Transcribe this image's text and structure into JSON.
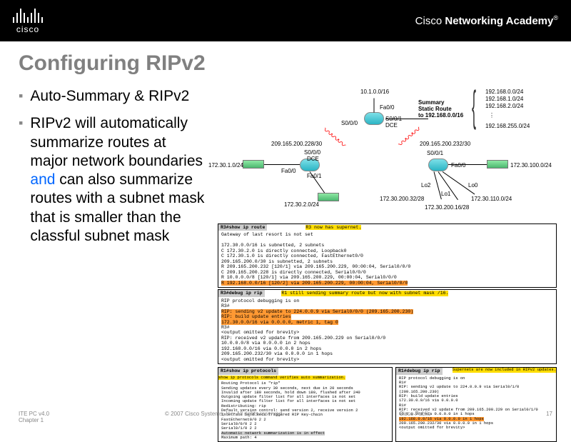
{
  "header": {
    "brand": "cisco",
    "academy_plain": "Cisco ",
    "academy_bold": "Networking Academy"
  },
  "title": "Configuring RIPv2",
  "bullets": {
    "b1": "Auto-Summary & RIPv2",
    "b2a": "RIPv2 will automatically summarize routes at major network boundaries ",
    "b2emph": "and",
    "b2b": " can also summarize routes with a subnet mask that is smaller than the classful subnet mask"
  },
  "diagram": {
    "top": "10.1.0.0/16",
    "sum1": "Summary",
    "sum2": "Static Route",
    "sum3": "to 192.168.0.0/16",
    "nets_right": [
      "192.168.0.0/24",
      "192.168.1.0/24",
      "192.168.2.0/24",
      "192.168.255.0/24"
    ],
    "r2_fa00": "Fa0/0",
    "r2_s000": "S0/0/0",
    "r2_s001": "S0/0/1",
    "dce": "DCE",
    "link_l": "209.165.200.228/30",
    "link_r": "209.165.200.232/30",
    "r1_fa00": "Fa0/0",
    "r1_fa01": "Fa0/1",
    "r1_s000": "S0/0/0",
    "r3_s001": "S0/0/1",
    "r3_fa00": "Fa0/0",
    "lo0": "Lo0",
    "lo1": "Lo1",
    "lo2": "Lo2",
    "n_l1": "172.30.1.0/24",
    "n_l2": "172.30.2.0/24",
    "n_r1": "172.30.100.0/24",
    "n_rlo": "172.30.200.32/28",
    "n_rlo1": "172.30.200.16/28",
    "n_rlo0": "172.30.110.0/24"
  },
  "t1": {
    "cmd": "R3#show ip route",
    "note1": "R3 now has supernet.",
    "l0": "Gateway of last resort is not set",
    "l1": "     172.30.0.0/16 is subnetted, 2 subnets",
    "l2": "C       172.30.2.0 is directly connected, Loopback0",
    "l3": "C       172.30.1.0 is directly connected, FastEthernet0/0",
    "l4": "     209.165.200.0/30 is subnetted, 2 subnets",
    "l5": "R       209.165.200.232 [120/1] via 209.165.200.229, 00:00:04, Serial0/0/0",
    "l6": "C       209.165.200.228 is directly connected, Serial0/0/0",
    "l7": "R    10.0.0.0/8 [120/1] via 209.165.200.229, 00:00:04, Serial0/0/0",
    "l8": "R    192.168.0.0/16 [120/2] via 209.165.200.229, 00:00:04, Serial0/0/0"
  },
  "t2": {
    "cmd": "R3#debug ip rip",
    "note1": "R1 still sending summary route but now with subnet mask /16.",
    "l0": "RIP protocol debugging is on",
    "l1": "R3#",
    "l2": "RIP: sending v2 update to 224.0.0.9 via Serial0/0/0 (209.165.200.230)",
    "l3": "RIP: build update entries",
    "l4": "      172.30.0.0/16 via 0.0.0.0, metric 1, tag 0",
    "l5": "R3#",
    "l6": "<output omitted for brevity>",
    "l7": "RIP: received v2 update from 209.165.200.229 on Serial0/0/0",
    "l8": "      10.0.0.0/8 via 0.0.0.0 in 2 hops",
    "l9": "      192.168.0.0/16 via 0.0.0.0 in 2 hops",
    "l10": "      209.165.200.232/30 via 0.0.0.0 in 1 hops",
    "l11": "<output omitted for brevity>"
  },
  "t3": {
    "cmd": "R1#show ip protocols",
    "note1": "show ip protocols command verifies auto summarization.",
    "l0": "Routing Protocol is \"rip\"",
    "l1": "  Sending updates every 30 seconds, next due in 20 seconds",
    "l2": "  Invalid after 180 seconds, hold down 180, flushed after 240",
    "l3": "  Outgoing update filter list for all interfaces is not set",
    "l4": "  Incoming update filter list for all interfaces is not set",
    "l5": "  Redistributing: rip",
    "l6": "  Default version control: send version 2, receive version 2",
    "l7": "    Interface             Send  Recv  Triggered RIP  Key-chain",
    "l8": "    FastEthernet0/0       2     2",
    "l9": "    Serial0/0/0           2     2",
    "l10": "    Serial0/1/0           2     2",
    "l11": "  Automatic network summarization is in effect",
    "l12": "  Maximum path: 4"
  },
  "t4": {
    "cmd": "R1#debug ip rip",
    "note1": "Supernets are now included in RIPv2 updates.",
    "l0": "RIP protocol debugging is on",
    "l1": "R1#",
    "l2": "RIP: sending v2 update to 224.0.0.9 via Serial0/1/0 (209.165.200.230)",
    "l3": "RIP: build update entries",
    "l4": "      172.30.0.0/16 via 0.0.0.0",
    "l5": "R1#",
    "l6": "RIP: received v2 update from 209.165.200.229 on Serial0/1/0",
    "l7": "      10.0.0.0/8 via 0.0.0.0 in 1 hops",
    "l8": "      192.168.0.0/16 via 0.0.0.0 in 1 hops",
    "l9": "      209.165.200.232/30 via 0.0.0.0 in 1 hops",
    "l10": "<output omitted for brevity>"
  },
  "footer": {
    "left1": "ITE PC v4.0",
    "left2": "Chapter 1",
    "center": "© 2007 Cisco Systems, Inc. All rights reserved.",
    "right": "Cisco Public",
    "page": "17"
  }
}
